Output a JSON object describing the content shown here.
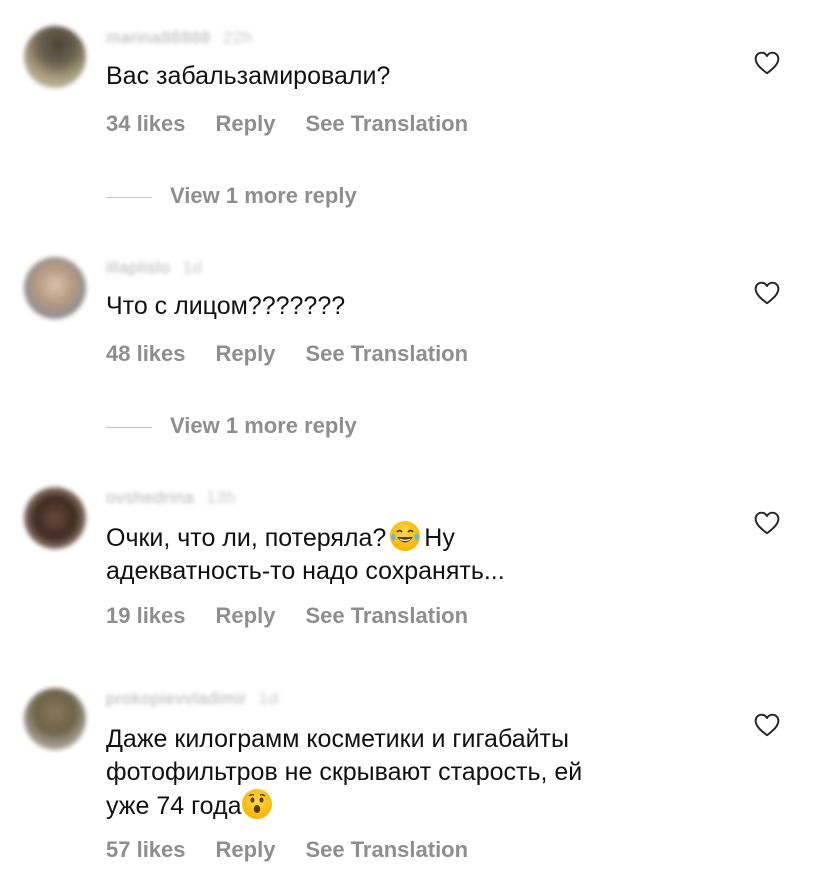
{
  "comments": [
    {
      "username": "marina88888",
      "age": "22h",
      "text_lines": [
        "Вас забальзамировали?"
      ],
      "likes": "34 likes",
      "reply": "Reply",
      "translate": "See Translation",
      "view_more": "View 1 more reply"
    },
    {
      "username": "illaplislo",
      "age": "1d",
      "text_lines": [
        "Что с лицом???????"
      ],
      "likes": "48 likes",
      "reply": "Reply",
      "translate": "See Translation",
      "view_more": "View 1 more reply"
    },
    {
      "username": "ovshedrina",
      "age": "13h",
      "text_line1_before": "Очки, что ли, потеряла?",
      "text_line1_after": "Ну",
      "text_line2": "адекватность-то надо сохранять...",
      "emoji": "joy-emoji",
      "likes": "19 likes",
      "reply": "Reply",
      "translate": "See Translation"
    },
    {
      "username": "prokopievvladimir",
      "age": "1d",
      "text_line1": "Даже килограмм косметики и гигабайты",
      "text_line2": "фотофильтров не скрывают старость, ей",
      "text_line3": "уже 74 года",
      "emoji": "astonished-emoji",
      "likes": "57 likes",
      "reply": "Reply",
      "translate": "See Translation"
    }
  ],
  "colors": {
    "text": "#111111",
    "meta": "#8e8e8e",
    "divider": "#c7c7c7",
    "background": "#ffffff"
  },
  "icons": {
    "like": "heart-outline-icon"
  }
}
